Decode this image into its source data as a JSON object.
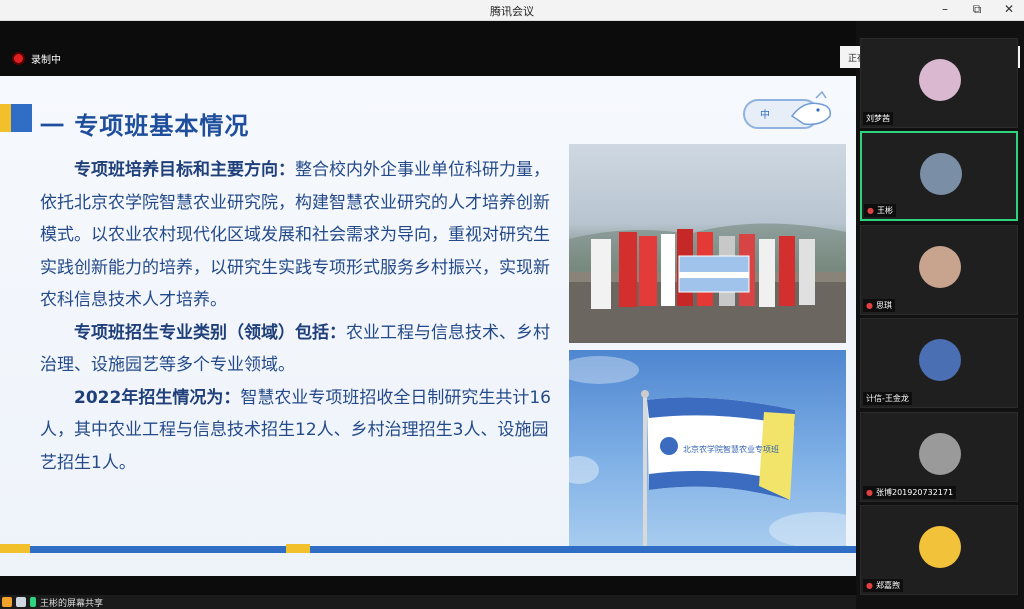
{
  "window": {
    "title": "腾讯会议",
    "controls": [
      "–",
      "⧉",
      "✕"
    ]
  },
  "recording": {
    "label": "录制中"
  },
  "slide": {
    "heading": "一 专项班基本情况",
    "logo_text": "中",
    "paragraphs": [
      {
        "bold": "专项班培养目标和主要方向：",
        "text": "整合校内外企事业单位科研力量，依托北京农学院智慧农业研究院，构建智慧农业研究的人才培养创新模式。以农业农村现代化区域发展和社会需求为导向，重视对研究生实践创新能力的培养，以研究生实践专项形式服务乡村振兴，实现新农科信息技术人才培养。"
      },
      {
        "bold": "专项班招生专业类别（领域）包括：",
        "text": "农业工程与信息技术、乡村治理、设施园艺等多个专业领域。"
      },
      {
        "bold": "2022年招生情况为：",
        "text": "智慧农业专项班招收全日制研究生共计16人，其中农业工程与信息技术招生12人、乡村治理招生3人、设施园艺招生1人。"
      }
    ],
    "flag_text": "北京农学院智慧农业专项班"
  },
  "statusbar": {
    "label": "王彬的屏幕共享"
  },
  "speaking": {
    "label": "正在讲话: 王彬"
  },
  "participants": [
    {
      "name": "刘梦茜",
      "color": "#d9b8d0"
    },
    {
      "name": "王彬",
      "color": "#7a8fa6",
      "active": true
    },
    {
      "name": "思琪",
      "color": "#c8a48e"
    },
    {
      "name": "计信-王金龙",
      "color": "#4a6fb2"
    },
    {
      "name": "张博201920732171",
      "color": "#9a9a9a"
    },
    {
      "name": "郑嘉煦",
      "color": "#f2c23a"
    }
  ],
  "colors": {
    "accent_blue": "#2f6ec4",
    "accent_yellow": "#f1c02b",
    "active_border": "#2ed37d"
  }
}
